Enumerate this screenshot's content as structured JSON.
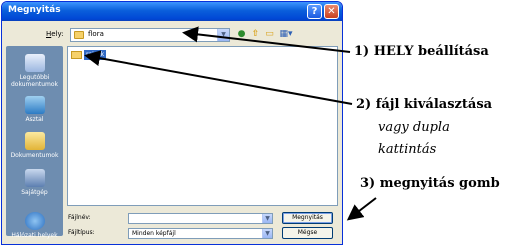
{
  "window": {
    "title": "Megnyitás",
    "help_button": "?",
    "close_button": "✕"
  },
  "location": {
    "label_prefix": "H",
    "label_rest": "ely:",
    "value": "flora"
  },
  "places": [
    {
      "label": "Legutóbbi dokumentumok",
      "icon": "recent-docs-icon"
    },
    {
      "label": "Asztal",
      "icon": "desktop-icon"
    },
    {
      "label": "Dokumentumok",
      "icon": "documents-icon"
    },
    {
      "label": "Sajátgép",
      "icon": "my-computer-icon"
    },
    {
      "label": "Hálózati helyek",
      "icon": "network-places-icon"
    }
  ],
  "files": [
    {
      "name": "rajzok",
      "selected": true
    }
  ],
  "filename": {
    "label": "Fájlnév:",
    "value": ""
  },
  "filetype": {
    "label": "Fájltípus:",
    "value": "Minden képfájl"
  },
  "buttons": {
    "open": "Megnyitás",
    "cancel": "Mégse"
  },
  "annotations": {
    "step1": "1) HELY beállítása",
    "step2": "2) fájl kiválasztása",
    "step2_italic_1": "vagy dupla",
    "step2_italic_2": "kattintás",
    "step3": "3) megnyitás gomb"
  },
  "colors": {
    "title_bar": "#0A5FDB",
    "dialog_bg": "#ECE9D8",
    "places_bar": "#6E8DB0",
    "selection": "#316AC5"
  }
}
